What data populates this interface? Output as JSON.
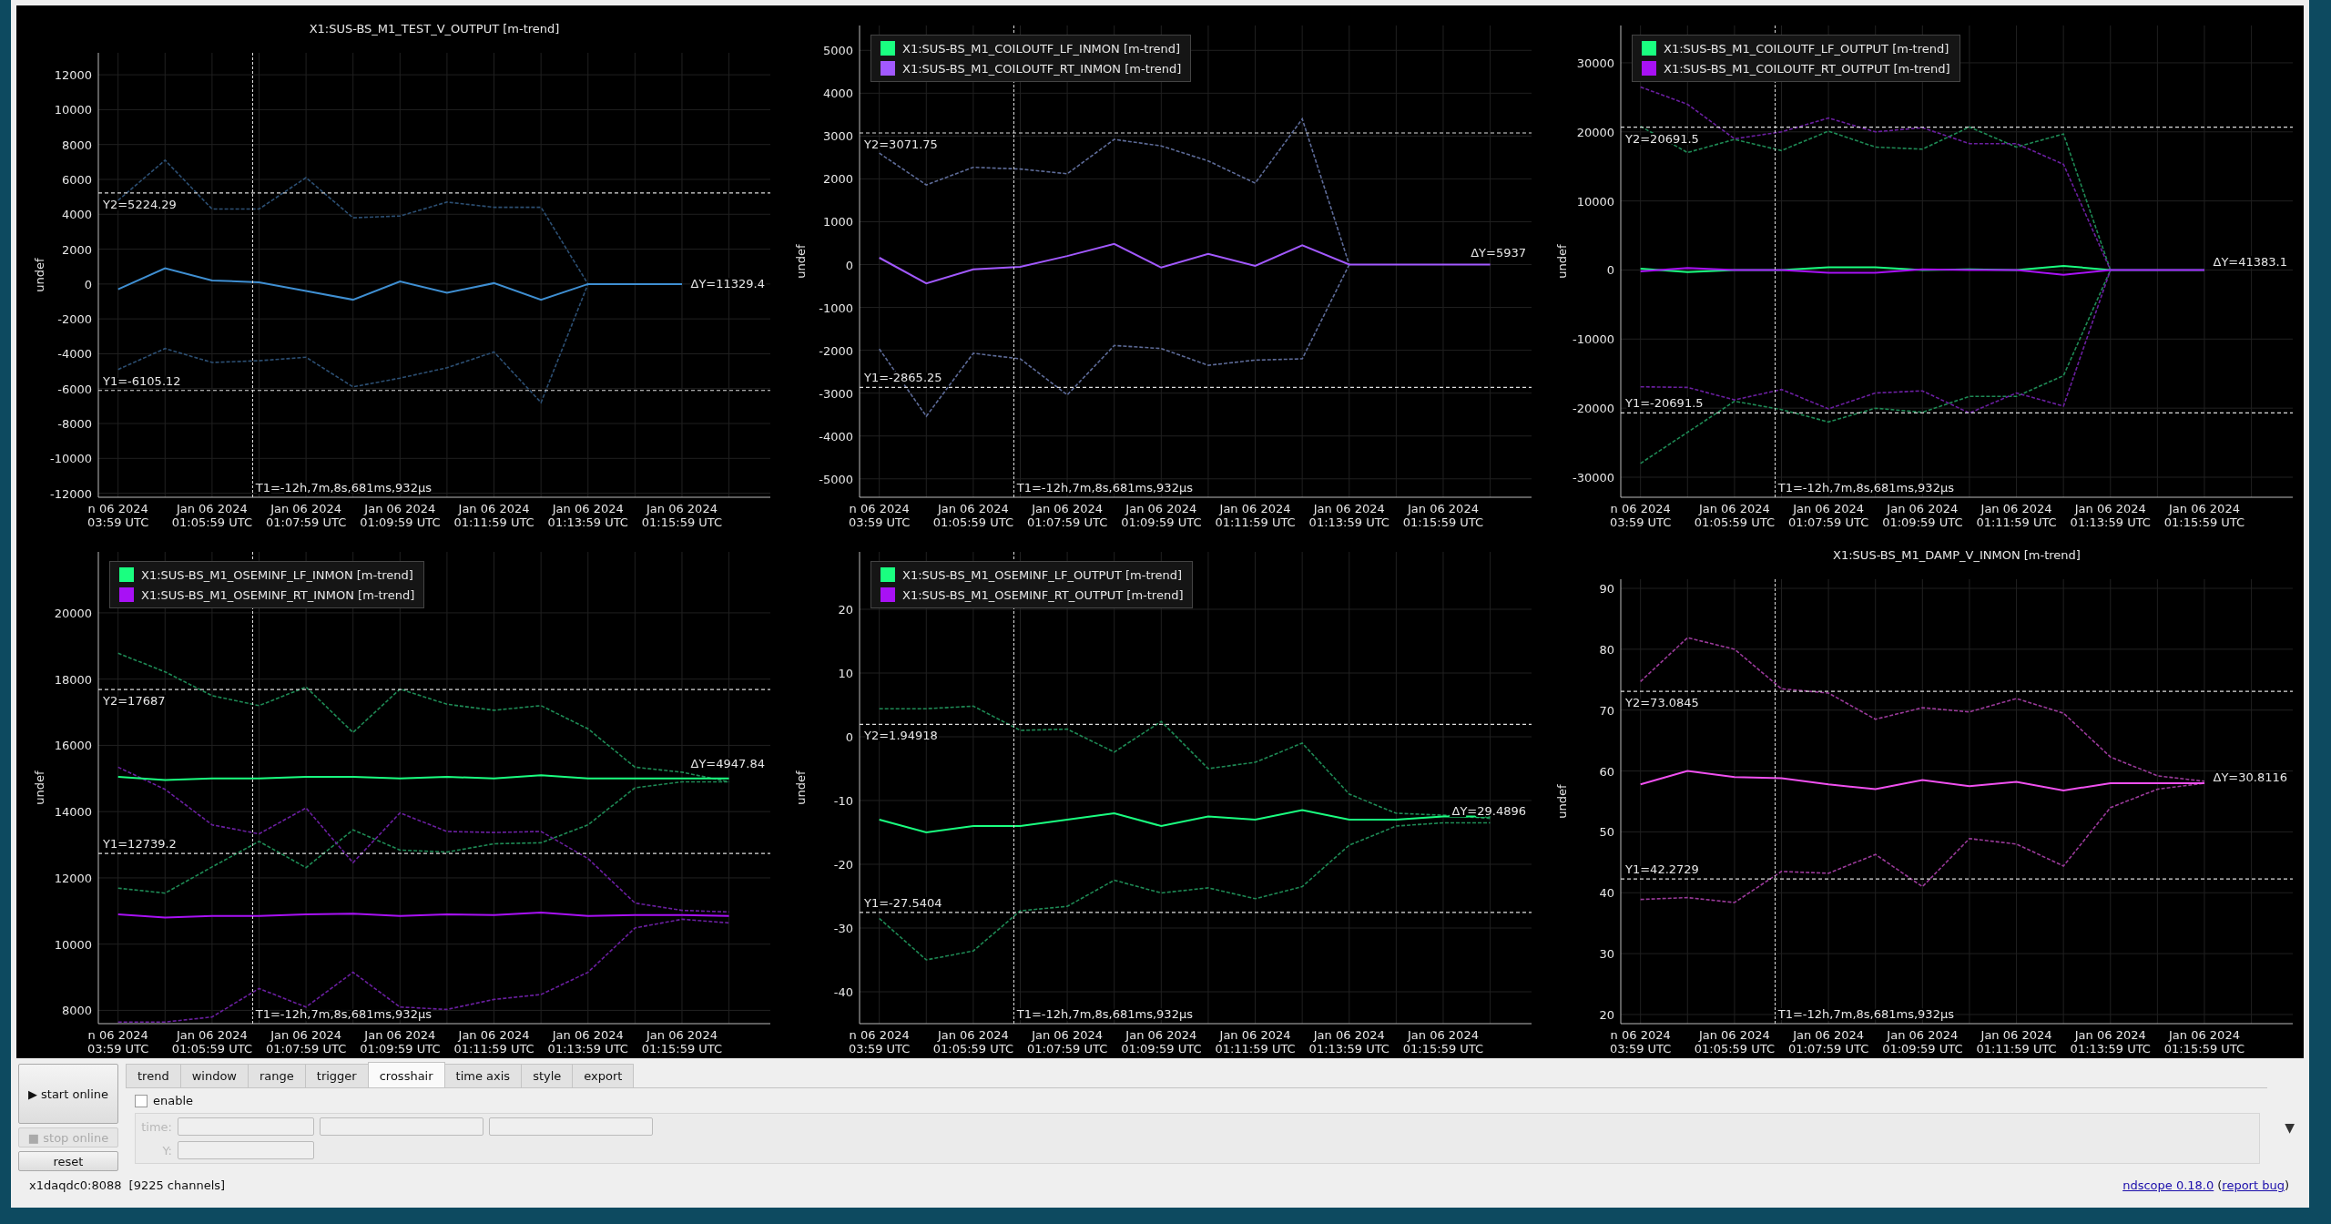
{
  "plots": [
    {
      "chart_data": {
        "type": "line",
        "title": "X1:SUS-BS_M1_TEST_V_OUTPUT [m-trend]",
        "ylabel": "undef",
        "grid": true,
        "ylim": [
          -12230,
          13260
        ],
        "yticks": [
          -12000,
          -10000,
          -8000,
          -6000,
          -4000,
          -2000,
          0,
          2000,
          4000,
          6000,
          8000,
          10000,
          12000
        ],
        "categories": [
          "n 06 2024\n03:59 UTC",
          null,
          "Jan 06 2024\n01:05:59 UTC",
          null,
          "Jan 06 2024\n01:07:59 UTC",
          null,
          "Jan 06 2024\n01:09:59 UTC",
          null,
          "Jan 06 2024\n01:11:59 UTC",
          null,
          "Jan 06 2024\n01:13:59 UTC",
          null,
          "Jan 06 2024\n01:15:59 UTC"
        ],
        "series": [
          {
            "color": "#2c4f73",
            "line_style": "dashed",
            "values": [
              4800,
              7100,
              4300,
              4300,
              6100,
              3800,
              3900,
              4700,
              4400,
              4400,
              0,
              null,
              null
            ]
          },
          {
            "color": "#2c4f73",
            "line_style": "dashed",
            "values": [
              -4900,
              -3700,
              -4500,
              -4400,
              -4200,
              -5900,
              -5400,
              -4800,
              -3900,
              -6800,
              0,
              null,
              null
            ]
          },
          {
            "color": "#3f8fd2",
            "line_style": "solid",
            "values": [
              -300,
              900,
              200,
              100,
              -400,
              -900,
              150,
              -500,
              50,
              -900,
              0,
              0,
              0
            ]
          }
        ],
        "ref_lines": [
          {
            "axis": "y",
            "value": 5224.29,
            "label": "Y2=5224.29"
          },
          {
            "axis": "y",
            "value": -6105.12,
            "label": "Y1=-6105.12"
          }
        ],
        "annotations": [
          "T1=-12h,7m,8s,681ms,932µs",
          "ΔY=11329.4"
        ]
      }
    },
    {
      "chart_data": {
        "type": "line",
        "ylabel": "undef",
        "grid": true,
        "ylim": [
          -5430,
          5580
        ],
        "yticks": [
          -5000,
          -4000,
          -3000,
          -2000,
          -1000,
          0,
          1000,
          2000,
          3000,
          4000,
          5000
        ],
        "categories": [
          "n 06 2024\n03:59 UTC",
          null,
          "Jan 06 2024\n01:05:59 UTC",
          null,
          "Jan 06 2024\n01:07:59 UTC",
          null,
          "Jan 06 2024\n01:09:59 UTC",
          null,
          "Jan 06 2024\n01:11:59 UTC",
          null,
          "Jan 06 2024\n01:13:59 UTC",
          null,
          "Jan 06 2024\n01:15:59 UTC",
          null
        ],
        "series": [
          {
            "color": "#5d6b98",
            "line_style": "dashed",
            "values": [
              2600,
              1860,
              2270,
              2230,
              2120,
              2920,
              2770,
              2420,
              1900,
              3400,
              0,
              null,
              null,
              null
            ]
          },
          {
            "color": "#5d6b98",
            "line_style": "dashed",
            "values": [
              -1970,
              -3540,
              -2070,
              -2200,
              -3040,
              -1890,
              -1960,
              -2350,
              -2230,
              -2200,
              0,
              null,
              null,
              null
            ]
          },
          {
            "name": "X1:SUS-BS_M1_COILOUTF_LF_INMON [m-trend]",
            "color": "#1aff80",
            "values": [
              null,
              null,
              null,
              null,
              null,
              null,
              null,
              null,
              null,
              null,
              null,
              null,
              null,
              null
            ]
          },
          {
            "name": "X1:SUS-BS_M1_COILOUTF_RT_INMON [m-trend]",
            "color": "#a259ff",
            "line_style": "solid",
            "values": [
              160,
              -440,
              -110,
              -50,
              200,
              480,
              -70,
              250,
              -30,
              450,
              0,
              0,
              0,
              0
            ]
          }
        ],
        "ref_lines": [
          {
            "axis": "y",
            "value": 3071.75,
            "label": "Y2=3071.75"
          },
          {
            "axis": "y",
            "value": -2865.25,
            "label": "Y1=-2865.25"
          }
        ],
        "annotations": [
          "T1=-12h,7m,8s,681ms,932µs",
          "ΔY=5937"
        ]
      }
    },
    {
      "chart_data": {
        "type": "line",
        "ylabel": "undef",
        "grid": true,
        "ylim": [
          -32900,
          35400
        ],
        "yticks": [
          -30000,
          -20000,
          -10000,
          0,
          10000,
          20000,
          30000
        ],
        "categories": [
          "n 06 2024\n03:59 UTC",
          null,
          "Jan 06 2024\n01:05:59 UTC",
          null,
          "Jan 06 2024\n01:07:59 UTC",
          null,
          "Jan 06 2024\n01:09:59 UTC",
          null,
          "Jan 06 2024\n01:11:59 UTC",
          null,
          "Jan 06 2024\n01:13:59 UTC",
          null,
          "Jan 06 2024\n01:15:59 UTC"
        ],
        "series": [
          {
            "color": "#1e8a55",
            "line_style": "dashed",
            "values": [
              20800,
              17000,
              18900,
              17300,
              20100,
              17800,
              17500,
              20700,
              17800,
              19700,
              0,
              null,
              null
            ]
          },
          {
            "color": "#1e8a55",
            "line_style": "dashed",
            "values": [
              -28000,
              -23500,
              -19000,
              -20200,
              -22000,
              -20000,
              -20600,
              -18300,
              -18300,
              -15300,
              0,
              null,
              null
            ]
          },
          {
            "color": "#6a1fa0",
            "line_style": "dashed",
            "values": [
              26500,
              24000,
              19000,
              20000,
              22000,
              20000,
              20600,
              18300,
              18300,
              15300,
              0,
              null,
              null
            ]
          },
          {
            "color": "#6a1fa0",
            "line_style": "dashed",
            "values": [
              -16900,
              -17000,
              -18800,
              -17300,
              -20100,
              -17800,
              -17500,
              -20700,
              -17800,
              -19700,
              0,
              null,
              null
            ]
          },
          {
            "name": "X1:SUS-BS_M1_COILOUTF_LF_OUTPUT [m-trend]",
            "color": "#1aff80",
            "line_style": "solid",
            "values": [
              200,
              -300,
              0,
              0,
              400,
              400,
              0,
              100,
              0,
              600,
              0,
              0,
              0
            ]
          },
          {
            "name": "X1:SUS-BS_M1_COILOUTF_RT_OUTPUT [m-trend]",
            "color": "#a811f5",
            "line_style": "solid",
            "values": [
              -200,
              300,
              0,
              0,
              -400,
              -400,
              100,
              0,
              0,
              -700,
              0,
              0,
              0
            ]
          }
        ],
        "ref_lines": [
          {
            "axis": "y",
            "value": 20691.5,
            "label": "Y2=20691.5"
          },
          {
            "axis": "y",
            "value": -20691.5,
            "label": "Y1=-20691.5"
          }
        ],
        "annotations": [
          "T1=-12h,7m,8s,681ms,932µs",
          "ΔY=41383.1"
        ]
      }
    },
    {
      "chart_data": {
        "type": "line",
        "ylabel": "undef",
        "grid": true,
        "ylim": [
          7600,
          21840
        ],
        "yticks": [
          8000,
          10000,
          12000,
          14000,
          16000,
          18000,
          20000
        ],
        "categories": [
          "n 06 2024\n03:59 UTC",
          null,
          "Jan 06 2024\n01:05:59 UTC",
          null,
          "Jan 06 2024\n01:07:59 UTC",
          null,
          "Jan 06 2024\n01:09:59 UTC",
          null,
          "Jan 06 2024\n01:11:59 UTC",
          null,
          "Jan 06 2024\n01:13:59 UTC",
          null,
          "Jan 06 2024\n01:15:59 UTC",
          null
        ],
        "series": [
          {
            "color": "#1e8a55",
            "line_style": "dashed",
            "values": [
              18780,
              18220,
              17500,
              17200,
              17760,
              16390,
              17700,
              17240,
              17060,
              17200,
              16500,
              15340,
              15190,
              14900
            ]
          },
          {
            "color": "#1e8a55",
            "line_style": "dashed",
            "values": [
              11690,
              11540,
              12330,
              13100,
              12310,
              13450,
              12840,
              12780,
              13030,
              13060,
              13600,
              14720,
              14900,
              14900
            ]
          },
          {
            "color": "#6a1fa0",
            "line_style": "dashed",
            "values": [
              15340,
              14670,
              13600,
              13330,
              14110,
              12460,
              13960,
              13400,
              13370,
              13400,
              12580,
              11240,
              11020,
              10970
            ]
          },
          {
            "color": "#6a1fa0",
            "line_style": "dashed",
            "values": [
              7650,
              7650,
              7800,
              8660,
              8100,
              9150,
              8100,
              8030,
              8330,
              8480,
              9150,
              10490,
              10750,
              10640
            ]
          },
          {
            "name": "X1:SUS-BS_M1_OSEMINF_LF_INMON [m-trend]",
            "color": "#1aff80",
            "line_style": "solid",
            "values": [
              15050,
              14950,
              15000,
              15000,
              15050,
              15050,
              15000,
              15050,
              15000,
              15100,
              15000,
              15000,
              15000,
              15000
            ]
          },
          {
            "name": "X1:SUS-BS_M1_OSEMINF_RT_INMON [m-trend]",
            "color": "#a811f5",
            "line_style": "solid",
            "values": [
              10900,
              10800,
              10850,
              10850,
              10900,
              10920,
              10850,
              10900,
              10880,
              10950,
              10850,
              10880,
              10880,
              10850
            ]
          }
        ],
        "ref_lines": [
          {
            "axis": "y",
            "value": 17687,
            "label": "Y2=17687"
          },
          {
            "axis": "y",
            "value": 12739.2,
            "label": "Y1=12739.2"
          }
        ],
        "annotations": [
          "T1=-12h,7m,8s,681ms,932µs",
          "ΔY=4947.84"
        ]
      }
    },
    {
      "chart_data": {
        "type": "line",
        "ylabel": "undef",
        "grid": true,
        "ylim": [
          -45,
          29
        ],
        "yticks": [
          -40,
          -30,
          -20,
          -10,
          0,
          10,
          20
        ],
        "categories": [
          "n 06 2024\n03:59 UTC",
          null,
          "Jan 06 2024\n01:05:59 UTC",
          null,
          "Jan 06 2024\n01:07:59 UTC",
          null,
          "Jan 06 2024\n01:09:59 UTC",
          null,
          "Jan 06 2024\n01:11:59 UTC",
          null,
          "Jan 06 2024\n01:13:59 UTC",
          null,
          "Jan 06 2024\n01:15:59 UTC",
          null
        ],
        "series": [
          {
            "color": "#1e8a55",
            "line_style": "dashed",
            "values": [
              4.4,
              4.4,
              4.8,
              1,
              1.2,
              -2.4,
              2.4,
              -5,
              -4,
              -1,
              -9,
              -12,
              -12.3,
              -12.8
            ]
          },
          {
            "color": "#1e8a55",
            "line_style": "dashed",
            "values": [
              -28.5,
              -35,
              -33.6,
              -27.3,
              -26.6,
              -22.5,
              -24.5,
              -23.7,
              -25.4,
              -23.5,
              -17,
              -14,
              -13.5,
              -13.5
            ]
          },
          {
            "name": "X1:SUS-BS_M1_OSEMINF_LF_OUTPUT [m-trend]",
            "color": "#1aff80",
            "line_style": "solid",
            "values": [
              -13,
              -15,
              -14,
              -14,
              -13,
              -12,
              -14,
              -12.5,
              -13,
              -11.5,
              -13,
              -13,
              -12.5,
              -12.5
            ]
          },
          {
            "name": "X1:SUS-BS_M1_OSEMINF_RT_OUTPUT [m-trend]",
            "color": "#a811f5",
            "values": [
              null,
              null,
              null,
              null,
              null,
              null,
              null,
              null,
              null,
              null,
              null,
              null,
              null,
              null
            ]
          }
        ],
        "ref_lines": [
          {
            "axis": "y",
            "value": 1.94918,
            "label": "Y2=1.94918"
          },
          {
            "axis": "y",
            "value": -27.5404,
            "label": "Y1=-27.5404"
          }
        ],
        "annotations": [
          "T1=-12h,7m,8s,681ms,932µs",
          "ΔY=29.4896"
        ]
      }
    },
    {
      "chart_data": {
        "type": "line",
        "title": "X1:SUS-BS_M1_DAMP_V_INMON [m-trend]",
        "ylabel": "undef",
        "grid": true,
        "ylim": [
          18.5,
          91.5
        ],
        "yticks": [
          20,
          30,
          40,
          50,
          60,
          70,
          80,
          90
        ],
        "categories": [
          "n 06 2024\n03:59 UTC",
          null,
          "Jan 06 2024\n01:05:59 UTC",
          null,
          "Jan 06 2024\n01:07:59 UTC",
          null,
          "Jan 06 2024\n01:09:59 UTC",
          null,
          "Jan 06 2024\n01:11:59 UTC",
          null,
          "Jan 06 2024\n01:13:59 UTC",
          null,
          "Jan 06 2024\n01:15:59 UTC"
        ],
        "series": [
          {
            "color": "#9a3a9a",
            "line_style": "dashed",
            "values": [
              74.7,
              81.9,
              80,
              73.5,
              72.8,
              68.5,
              70.4,
              69.7,
              71.9,
              69.5,
              62.3,
              59.2,
              58.3
            ]
          },
          {
            "color": "#9a3a9a",
            "line_style": "dashed",
            "values": [
              38.9,
              39.2,
              38.4,
              43.5,
              43.2,
              46.3,
              41,
              48.9,
              48,
              44.4,
              54,
              57,
              58
            ]
          },
          {
            "color": "#f050f0",
            "line_style": "solid",
            "values": [
              57.8,
              60,
              59,
              58.8,
              57.8,
              57,
              58.5,
              57.5,
              58.2,
              56.8,
              58,
              58,
              58
            ]
          }
        ],
        "ref_lines": [
          {
            "axis": "y",
            "value": 73.0845,
            "label": "Y2=73.0845"
          },
          {
            "axis": "y",
            "value": 42.2729,
            "label": "Y1=42.2729"
          }
        ],
        "annotations": [
          "T1=-12h,7m,8s,681ms,932µs",
          "ΔY=30.8116"
        ]
      }
    }
  ],
  "buttons": [
    {
      "label": "▶ start online",
      "disabled": false
    },
    {
      "label": "■ stop online",
      "disabled": true
    },
    {
      "label": "reset",
      "disabled": false
    }
  ],
  "tabs": [
    {
      "label": "trend",
      "selected": false
    },
    {
      "label": "window",
      "selected": false
    },
    {
      "label": "range",
      "selected": false
    },
    {
      "label": "trigger",
      "selected": false
    },
    {
      "label": "crosshair",
      "selected": true
    },
    {
      "label": "time axis",
      "selected": false
    },
    {
      "label": "style",
      "selected": false
    },
    {
      "label": "export",
      "selected": false
    }
  ],
  "crosshair": {
    "enable": {
      "label": "enable",
      "checked": false
    },
    "rows": [
      {
        "label": "time:",
        "disabled": true,
        "fields": [
          {
            "disabled": true
          },
          {
            "disabled": true
          },
          {
            "disabled": true
          }
        ]
      },
      {
        "label": "Y:",
        "disabled": true,
        "fields": [
          {
            "disabled": true
          }
        ]
      }
    ],
    "expand_arrow": "▼"
  },
  "status_bar": {
    "server": "x1daqdc0:8088",
    "channels": "[9225 channels]",
    "version_link": "ndscope 0.18.0",
    "open_paren": "(",
    "bug_link": "report bug",
    "close_paren": ")"
  }
}
